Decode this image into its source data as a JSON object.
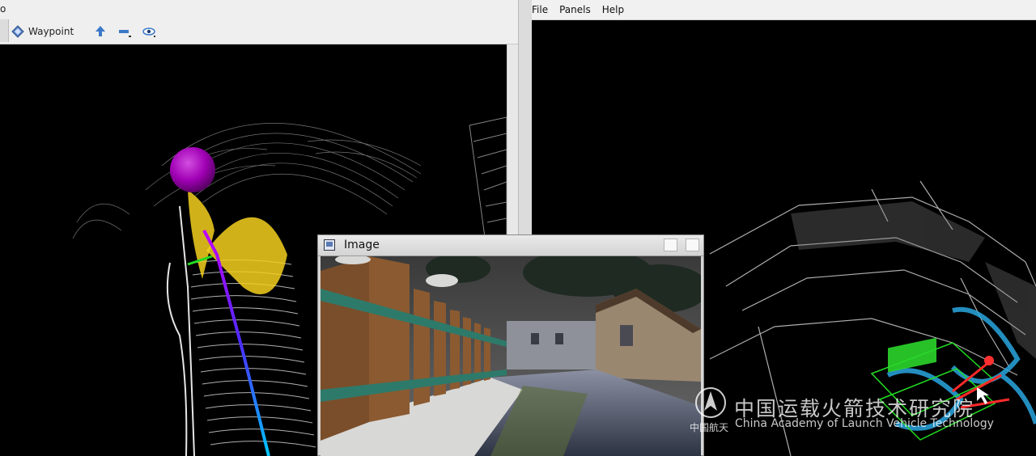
{
  "left_window": {
    "corner_text": "o",
    "toolbar": {
      "waypoint_label": "Waypoint",
      "icons": [
        "move-camera-icon",
        "measure-icon",
        "eye-icon"
      ]
    }
  },
  "right_window": {
    "menu": [
      "File",
      "Panels",
      "Help"
    ]
  },
  "image_window": {
    "title": "Image"
  },
  "watermark": {
    "cn": "中国运载火箭技术研究院",
    "en": "China Academy of Launch Vehicle Technology",
    "logo": "中国航天"
  },
  "colors": {
    "toolbar_bg": "#efefef",
    "sphere": "#a000b4",
    "cone": "#f5d01e",
    "path_start": "#c000ff",
    "path_end": "#00c8ff",
    "green_box": "#22dd22",
    "cyan_cloud": "#2aa6e0"
  }
}
